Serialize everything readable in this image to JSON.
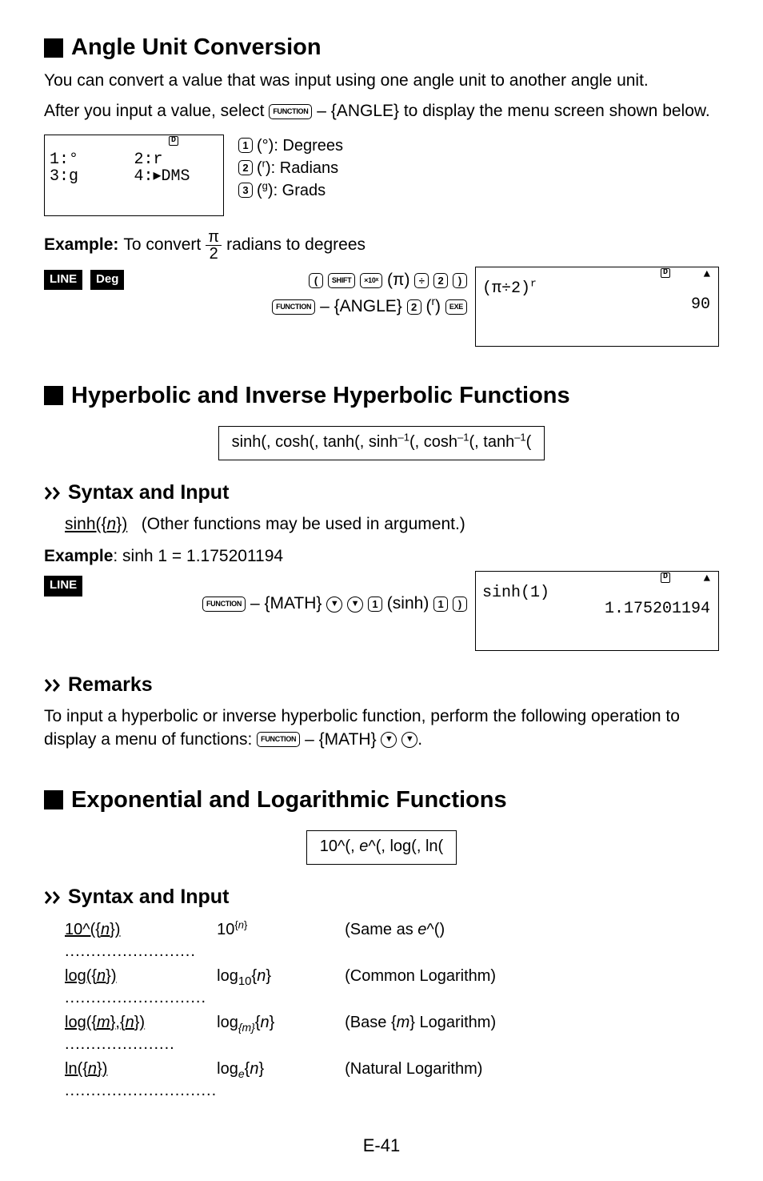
{
  "section1": {
    "title": "Angle Unit Conversion",
    "para1": "You can convert a value that was input using one angle unit to another angle unit.",
    "para2_pre": "After you input a value, select ",
    "para2_key": "FUNCTION",
    "para2_post": " – {ANGLE} to display the menu screen shown below.",
    "calc_screen": {
      "d_label": "D",
      "row1_left": "1:°",
      "row1_right": "2:r",
      "row2_left": "3:g",
      "row2_right": "4:▸DMS"
    },
    "key_legend": {
      "k1": "1",
      "k1_lbl": "(°): Degrees",
      "k2": "2",
      "k2_lbl": "(r): Radians",
      "k3": "3",
      "k3_lbl": "(g): Grads"
    },
    "example": {
      "label": "Example:",
      "pre": "To convert ",
      "frac_top": "π",
      "frac_bot": "2",
      "post": " radians to degrees"
    },
    "mode1": "LINE",
    "mode2": "Deg",
    "keyseq": {
      "open": "(",
      "shift": "SHIFT",
      "x10x": "×10x",
      "pi": "(π)",
      "div": "÷",
      "two": "2",
      "close": ")",
      "func": "FUNCTION",
      "angle": "– {ANGLE}",
      "two2": "2",
      "r": "(r)",
      "exe": "EXE"
    },
    "result_screen": {
      "d_label": "D",
      "up": "▲",
      "line1": "(π÷2)r",
      "ans": "90"
    }
  },
  "section2": {
    "title": "Hyperbolic and Inverse Hyperbolic Functions",
    "funcs": "sinh(, cosh(, tanh(, sinh⁻¹(, cosh⁻¹(, tanh⁻¹(",
    "syntax_input": "Syntax and Input",
    "syntax_line_pre": "sinh({",
    "syntax_line_n": "n",
    "syntax_line_post": "})",
    "syntax_line_note": "(Other functions may be used in argument.)",
    "example_label": "Example",
    "example_text": ": sinh 1 = 1.175201194",
    "mode1": "LINE",
    "keyseq": {
      "func": "FUNCTION",
      "math": "– {MATH}",
      "down1": "▼",
      "down2": "▼",
      "one1": "1",
      "sinh": "(sinh)",
      "one2": "1",
      "close": ")"
    },
    "result_screen": {
      "d_label": "D",
      "up": "▲",
      "line1": "sinh(1)",
      "ans": "1.175201194"
    },
    "remarks_title": "Remarks",
    "remarks_text_pre": "To input a hyperbolic or inverse hyperbolic function, perform the following operation to display a menu of functions: ",
    "remarks_func": "FUNCTION",
    "remarks_math": " – {MATH}"
  },
  "section3": {
    "title": "Exponential and Logarithmic Functions",
    "funcs_pre": "10^(, ",
    "funcs_e": "e",
    "funcs_post": "^(, log(, ln(",
    "syntax_input": "Syntax and Input",
    "rows": [
      {
        "lhs_u": "10^({n})",
        "rhs": "10",
        "rhs_sup_pre": "{",
        "rhs_sup_it": "n",
        "rhs_sup_post": "}",
        "note_pre": "(Same as ",
        "note_it": "e",
        "note_post": "^()"
      },
      {
        "lhs_u": "log({n})",
        "rhs": "log",
        "rhs_sub": "10",
        "rhs_arg_pre": "{",
        "rhs_arg_it": "n",
        "rhs_arg_post": "}",
        "note": "(Common Logarithm)"
      },
      {
        "lhs_u": "log({m},{n})",
        "rhs": "log",
        "rhs_sub_it_pre": "{",
        "rhs_sub_it": "m",
        "rhs_sub_it_post": "}",
        "rhs_arg_pre2": "{",
        "rhs_arg_it2": "n",
        "rhs_arg_post2": "}",
        "note_pre2": "(Base {",
        "note_it2": "m",
        "note_post2": "} Logarithm)"
      },
      {
        "lhs_u": "ln({n})",
        "rhs": "log",
        "rhs_sub_it2": "e",
        "rhs_arg_pre3": "{",
        "rhs_arg_it3": "n",
        "rhs_arg_post3": "}",
        "note3": "(Natural Logarithm)"
      }
    ]
  },
  "page_number": "E-41"
}
